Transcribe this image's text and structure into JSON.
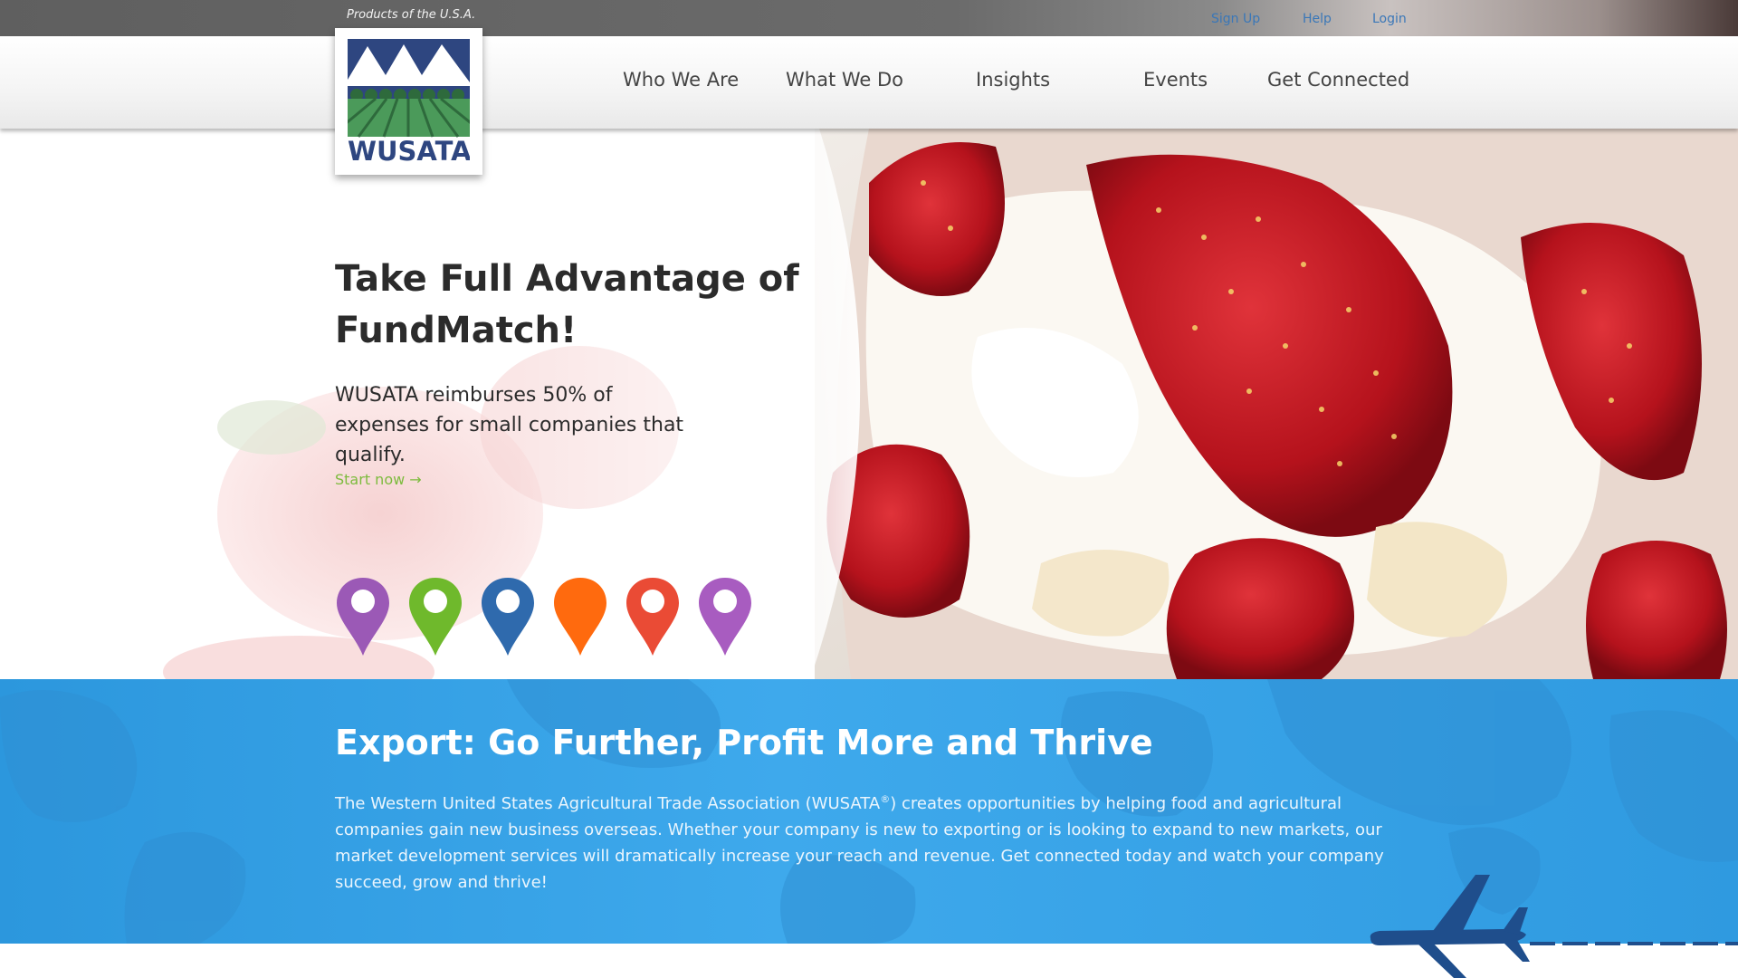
{
  "topbar": {
    "tagline": "Products of the U.S.A.",
    "links": {
      "signup": "Sign Up",
      "help": "Help",
      "login": "Login"
    }
  },
  "logo": {
    "wordmark": "WUSATA"
  },
  "nav": {
    "items": [
      {
        "label": "Who We Are"
      },
      {
        "label": "What We Do"
      },
      {
        "label": "Insights"
      },
      {
        "label": "Events"
      },
      {
        "label": "Get Connected"
      }
    ]
  },
  "hero": {
    "title": "Take Full Advantage of FundMatch!",
    "subtitle": "WUSATA reimburses 50% of expenses for small companies that qualify.",
    "cta": "Start now →",
    "pins": [
      {
        "icon": "map-pin-icon",
        "color": "#9b59b6"
      },
      {
        "icon": "map-pin-icon",
        "color": "#6fb92c"
      },
      {
        "icon": "map-pin-icon",
        "color": "#2f6aad"
      },
      {
        "icon": "map-pin-icon",
        "color": "#ff6a0e"
      },
      {
        "icon": "map-pin-icon",
        "color": "#ea4b35"
      },
      {
        "icon": "map-pin-icon",
        "color": "#a85cc0"
      }
    ]
  },
  "export": {
    "title": "Export: Go Further, Profit More and Thrive",
    "body_before": "The Western United States Agricultural Trade Association (WUSATA",
    "body_mark": "®",
    "body_after": ") creates opportunities by helping food and agricultural companies gain new business overseas. Whether your company is new to exporting or is looking to expand to new markets, our market development services will dramatically increase your reach and revenue. Get connected today and watch your company succeed, grow and thrive!"
  },
  "colors": {
    "accent_green": "#7dbb3e",
    "band_blue": "#3ea9ec",
    "plane_navy": "#1f4e8c",
    "link_blue": "#3a77b8"
  }
}
